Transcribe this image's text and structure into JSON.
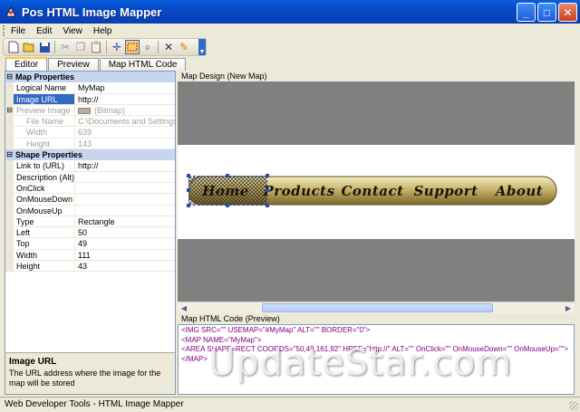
{
  "window": {
    "title": "Pos HTML Image Mapper"
  },
  "menu": [
    "File",
    "Edit",
    "View",
    "Help"
  ],
  "tabs": [
    "Editor",
    "Preview",
    "Map HTML Code"
  ],
  "map_properties": {
    "header": "Map Properties",
    "rows": [
      {
        "name": "Logical Name",
        "value": "MyMap"
      },
      {
        "name": "Image URL",
        "value": "http://"
      }
    ],
    "preview": {
      "name": "Preview Image",
      "value": "(Bitmap)"
    },
    "sub_rows": [
      {
        "name": "File Name",
        "value": "C:\\Documents and Settings\\Y"
      },
      {
        "name": "Width",
        "value": "639"
      },
      {
        "name": "Height",
        "value": "143"
      }
    ]
  },
  "shape_properties": {
    "header": "Shape Properties",
    "rows": [
      {
        "name": "Link to (URL)",
        "value": "http://"
      },
      {
        "name": "Description (Alt)",
        "value": ""
      },
      {
        "name": "OnClick",
        "value": ""
      },
      {
        "name": "OnMouseDown",
        "value": ""
      },
      {
        "name": "OnMouseUp",
        "value": ""
      },
      {
        "name": "Type",
        "value": "Rectangle"
      },
      {
        "name": "Left",
        "value": "50"
      },
      {
        "name": "Top",
        "value": "49"
      },
      {
        "name": "Width",
        "value": "111"
      },
      {
        "name": "Height",
        "value": "43"
      }
    ]
  },
  "help": {
    "title": "Image URL",
    "description": "The URL address where the image for the map will be stored"
  },
  "design": {
    "title": "Map Design (New Map)",
    "buttons": [
      "Home",
      "Products",
      "Contact",
      "Support",
      "About"
    ]
  },
  "code_pane": {
    "title": "Map HTML Code (Preview)",
    "lines": [
      "<IMG SRC=\"\" USEMAP=\"#MyMap\" ALT=\"\" BORDER=\"0\">",
      "<MAP NAME=\"MyMap\">",
      "<AREA SHAPE=RECT COORDS=\"50,49,161,92\" HREF=\"http://\" ALT=\"\" OnClick=\"\" OnMouseDown=\"\" OnMouseUp=\"\">",
      "</MAP>"
    ]
  },
  "watermark": "UpdateStar.com",
  "status": "Web Developer Tools - HTML Image Mapper",
  "colors": {
    "title_bar": "#0548c6",
    "selection": "#316ac5",
    "category": "#c6d6ef",
    "canvas": "#808080",
    "button_gold": "#c8b46a"
  }
}
